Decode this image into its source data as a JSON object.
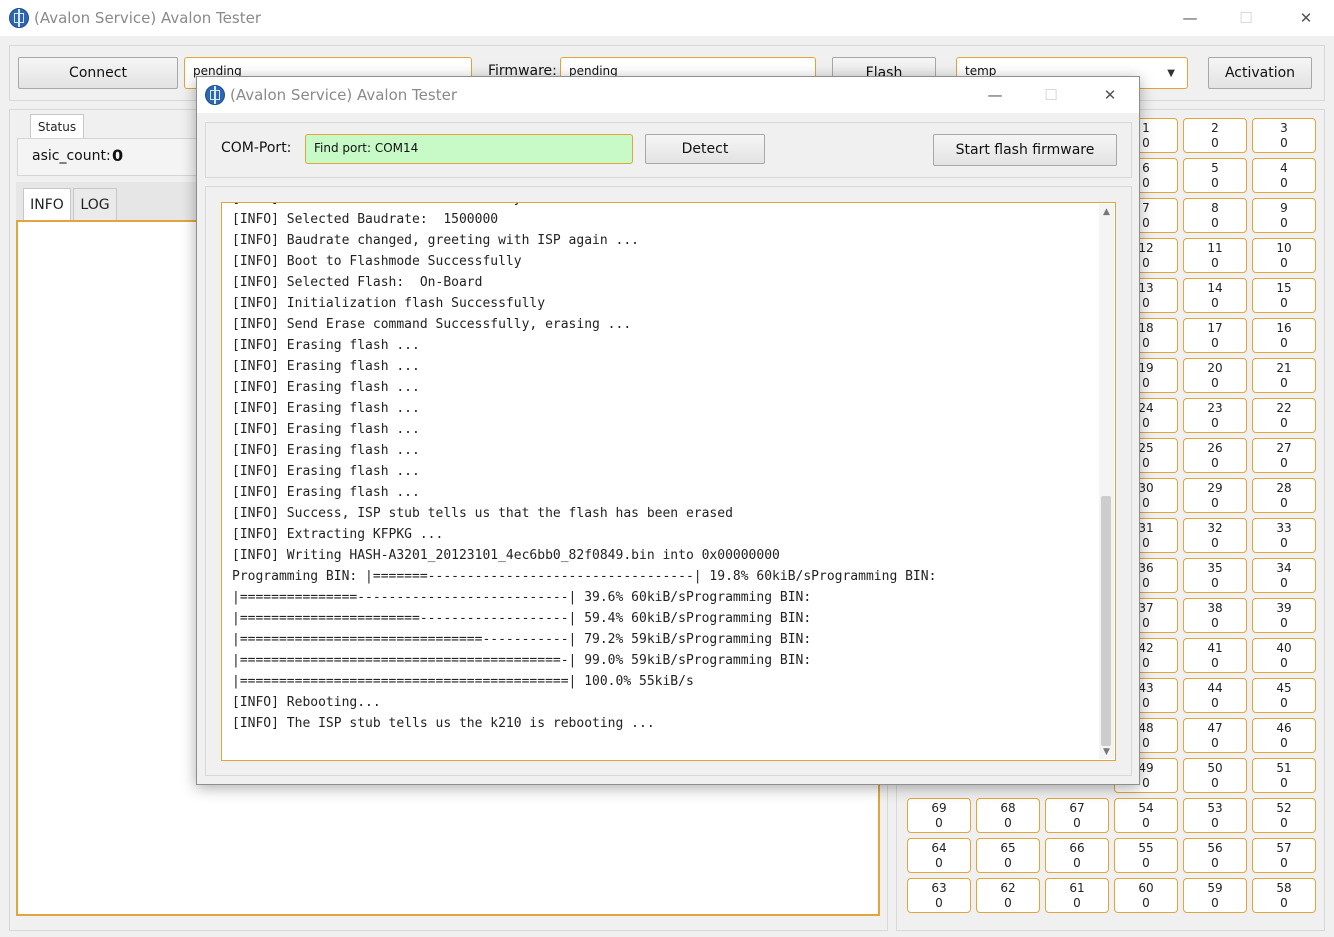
{
  "main_window": {
    "title": "(Avalon Service) Avalon Tester"
  },
  "toolbar": {
    "connect_label": "Connect",
    "port_value": "pending",
    "firmware_label": "Firmware:",
    "firmware_value": "pending",
    "flash_label": "Flash",
    "mode_value": "temp",
    "activation_label": "Activation"
  },
  "status": {
    "tab_label": "Status",
    "asic_count_label": "asic_count:",
    "asic_count_value": "0"
  },
  "info_tabs": [
    "INFO",
    "LOG"
  ],
  "grid_cells": [
    {
      "label": "1",
      "value": "0"
    },
    {
      "label": "2",
      "value": "0"
    },
    {
      "label": "3",
      "value": "0"
    },
    {
      "label": "6",
      "value": "0"
    },
    {
      "label": "5",
      "value": "0"
    },
    {
      "label": "4",
      "value": "0"
    },
    {
      "label": "7",
      "value": "0"
    },
    {
      "label": "8",
      "value": "0"
    },
    {
      "label": "9",
      "value": "0"
    },
    {
      "label": "12",
      "value": "0"
    },
    {
      "label": "11",
      "value": "0"
    },
    {
      "label": "10",
      "value": "0"
    },
    {
      "label": "13",
      "value": "0"
    },
    {
      "label": "14",
      "value": "0"
    },
    {
      "label": "15",
      "value": "0"
    },
    {
      "label": "18",
      "value": "0"
    },
    {
      "label": "17",
      "value": "0"
    },
    {
      "label": "16",
      "value": "0"
    },
    {
      "label": "19",
      "value": "0"
    },
    {
      "label": "20",
      "value": "0"
    },
    {
      "label": "21",
      "value": "0"
    },
    {
      "label": "24",
      "value": "0"
    },
    {
      "label": "23",
      "value": "0"
    },
    {
      "label": "22",
      "value": "0"
    },
    {
      "label": "25",
      "value": "0"
    },
    {
      "label": "26",
      "value": "0"
    },
    {
      "label": "27",
      "value": "0"
    },
    {
      "label": "30",
      "value": "0"
    },
    {
      "label": "29",
      "value": "0"
    },
    {
      "label": "28",
      "value": "0"
    },
    {
      "label": "31",
      "value": "0"
    },
    {
      "label": "32",
      "value": "0"
    },
    {
      "label": "33",
      "value": "0"
    },
    {
      "label": "36",
      "value": "0"
    },
    {
      "label": "35",
      "value": "0"
    },
    {
      "label": "34",
      "value": "0"
    },
    {
      "label": "37",
      "value": "0"
    },
    {
      "label": "38",
      "value": "0"
    },
    {
      "label": "39",
      "value": "0"
    },
    {
      "label": "42",
      "value": "0"
    },
    {
      "label": "41",
      "value": "0"
    },
    {
      "label": "40",
      "value": "0"
    },
    {
      "label": "43",
      "value": "0"
    },
    {
      "label": "44",
      "value": "0"
    },
    {
      "label": "45",
      "value": "0"
    },
    {
      "label": "48",
      "value": "0"
    },
    {
      "label": "47",
      "value": "0"
    },
    {
      "label": "46",
      "value": "0"
    },
    {
      "label": "49",
      "value": "0"
    },
    {
      "label": "50",
      "value": "0"
    },
    {
      "label": "51",
      "value": "0"
    },
    {
      "label": "69",
      "value": "0"
    },
    {
      "label": "68",
      "value": "0"
    },
    {
      "label": "67",
      "value": "0"
    },
    {
      "label": "54",
      "value": "0"
    },
    {
      "label": "53",
      "value": "0"
    },
    {
      "label": "52",
      "value": "0"
    },
    {
      "label": "64",
      "value": "0"
    },
    {
      "label": "65",
      "value": "0"
    },
    {
      "label": "66",
      "value": "0"
    },
    {
      "label": "55",
      "value": "0"
    },
    {
      "label": "56",
      "value": "0"
    },
    {
      "label": "57",
      "value": "0"
    },
    {
      "label": "63",
      "value": "0"
    },
    {
      "label": "62",
      "value": "0"
    },
    {
      "label": "61",
      "value": "0"
    },
    {
      "label": "60",
      "value": "0"
    },
    {
      "label": "59",
      "value": "0"
    },
    {
      "label": "58",
      "value": "0"
    }
  ],
  "dialog": {
    "title": "(Avalon Service) Avalon Tester",
    "com_port_label": "COM-Port:",
    "com_port_value": "Find port: COM14",
    "detect_label": "Detect",
    "start_flash_label": "Start flash firmware",
    "log_scroll_fraction": 1.0,
    "log_lines": [
      "[INFO] Boot to Flashmode Successfully",
      "[INFO] Selected Baudrate:  1500000",
      "[INFO] Baudrate changed, greeting with ISP again ...",
      "[INFO] Boot to Flashmode Successfully",
      "[INFO] Selected Flash:  On-Board",
      "[INFO] Initialization flash Successfully",
      "[INFO] Send Erase command Successfully, erasing ...",
      "[INFO] Erasing flash ...",
      "[INFO] Erasing flash ...",
      "[INFO] Erasing flash ...",
      "[INFO] Erasing flash ...",
      "[INFO] Erasing flash ...",
      "[INFO] Erasing flash ...",
      "[INFO] Erasing flash ...",
      "[INFO] Erasing flash ...",
      "[INFO] Success, ISP stub tells us that the flash has been erased",
      "[INFO] Extracting KFPKG ...",
      "[INFO] Writing HASH-A3201_20123101_4ec6bb0_82f0849.bin into 0x00000000",
      "Programming BIN: |=======----------------------------------| 19.8% 60kiB/sProgramming BIN:",
      "|===============---------------------------| 39.6% 60kiB/sProgramming BIN:",
      "|=======================-------------------| 59.4% 60kiB/sProgramming BIN:",
      "|===============================-----------| 79.2% 59kiB/sProgramming BIN:",
      "|=========================================-| 99.0% 59kiB/sProgramming BIN:",
      "|==========================================| 100.0% 55kiB/s",
      "[INFO] Rebooting...",
      "[INFO] The ISP stub tells us the k210 is rebooting ..."
    ]
  },
  "colors": {
    "accent_border": "#e1a53c",
    "com_port_bg": "#c8fac8",
    "app_icon": "#2e67b1"
  }
}
